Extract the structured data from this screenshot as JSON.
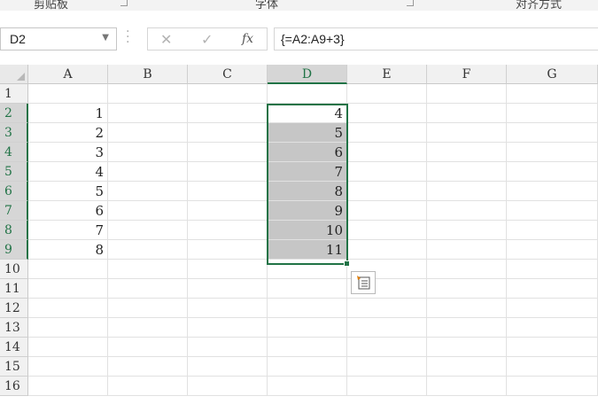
{
  "ribbon": {
    "groups": [
      "剪贴板",
      "字体",
      "对齐方式"
    ]
  },
  "formula_bar": {
    "name_box": "D2",
    "formula": "{=A2:A9+3}",
    "icons": [
      "chevron-down-icon",
      "cancel-icon",
      "enter-icon",
      "fx-icon"
    ]
  },
  "columns": [
    "A",
    "B",
    "C",
    "D",
    "E",
    "F",
    "G"
  ],
  "rows": [
    "1",
    "2",
    "3",
    "4",
    "5",
    "6",
    "7",
    "8",
    "9",
    "10",
    "11",
    "12",
    "13",
    "14",
    "15",
    "16"
  ],
  "selected_cell": {
    "column": "D",
    "rows": [
      "2",
      "9"
    ]
  },
  "data": {
    "A": [
      "1",
      "2",
      "3",
      "4",
      "5",
      "6",
      "7",
      "8"
    ],
    "D": [
      "4",
      "5",
      "6",
      "7",
      "8",
      "9",
      "10",
      "11"
    ]
  },
  "colors": {
    "accent": "#217346",
    "selection_fill": "#c6c6c6"
  },
  "quick_analysis_icon": "quick-analysis-icon"
}
